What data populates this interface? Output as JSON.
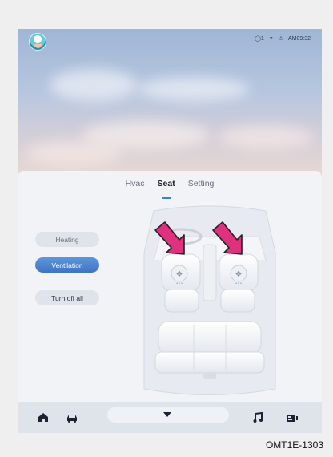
{
  "status": {
    "time": "AM09:32",
    "notif_count": "1"
  },
  "tabs": [
    {
      "label": "Hvac"
    },
    {
      "label": "Seat",
      "active": true
    },
    {
      "label": "Setting"
    }
  ],
  "seat_controls": {
    "heating_label": "Heating",
    "ventilation_label": "Ventilation",
    "turn_off_label": "Turn off all"
  },
  "dock": {
    "icons": [
      "home-icon",
      "car-icon",
      "expand-down-icon",
      "music-icon",
      "media-icon"
    ]
  },
  "caption": "OMT1E-1303",
  "colors": {
    "accent": "#3f7fd6",
    "arrow": "#e0317e"
  }
}
